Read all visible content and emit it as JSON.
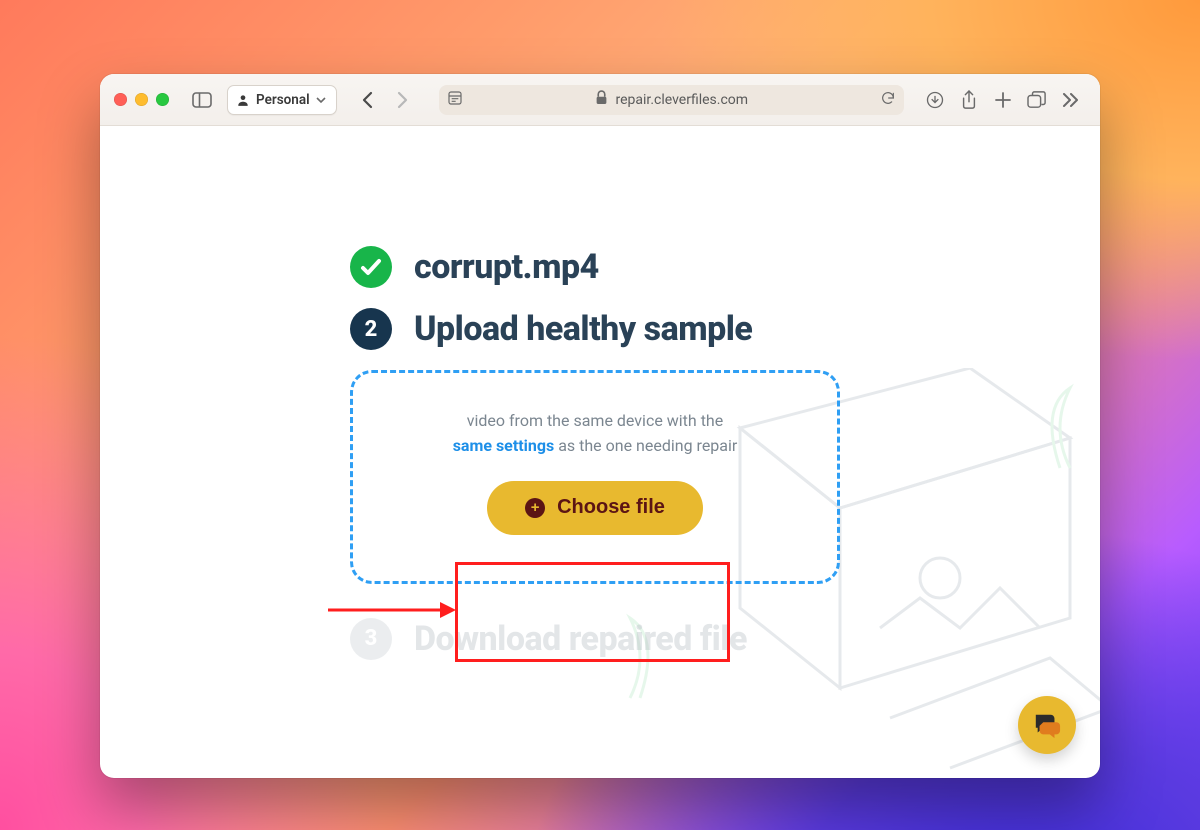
{
  "browser": {
    "profile_label": "Personal",
    "address_text": "repair.cleverfiles.com"
  },
  "steps": {
    "s1": {
      "title": "corrupt.mp4"
    },
    "s2": {
      "number": "2",
      "title": "Upload healthy sample",
      "hint_prefix": "video from the same device with the",
      "hint_link": "same settings",
      "hint_suffix": " as the one needing repair",
      "choose_label": "Choose file"
    },
    "s3": {
      "number": "3",
      "title": "Download repaired file"
    }
  }
}
